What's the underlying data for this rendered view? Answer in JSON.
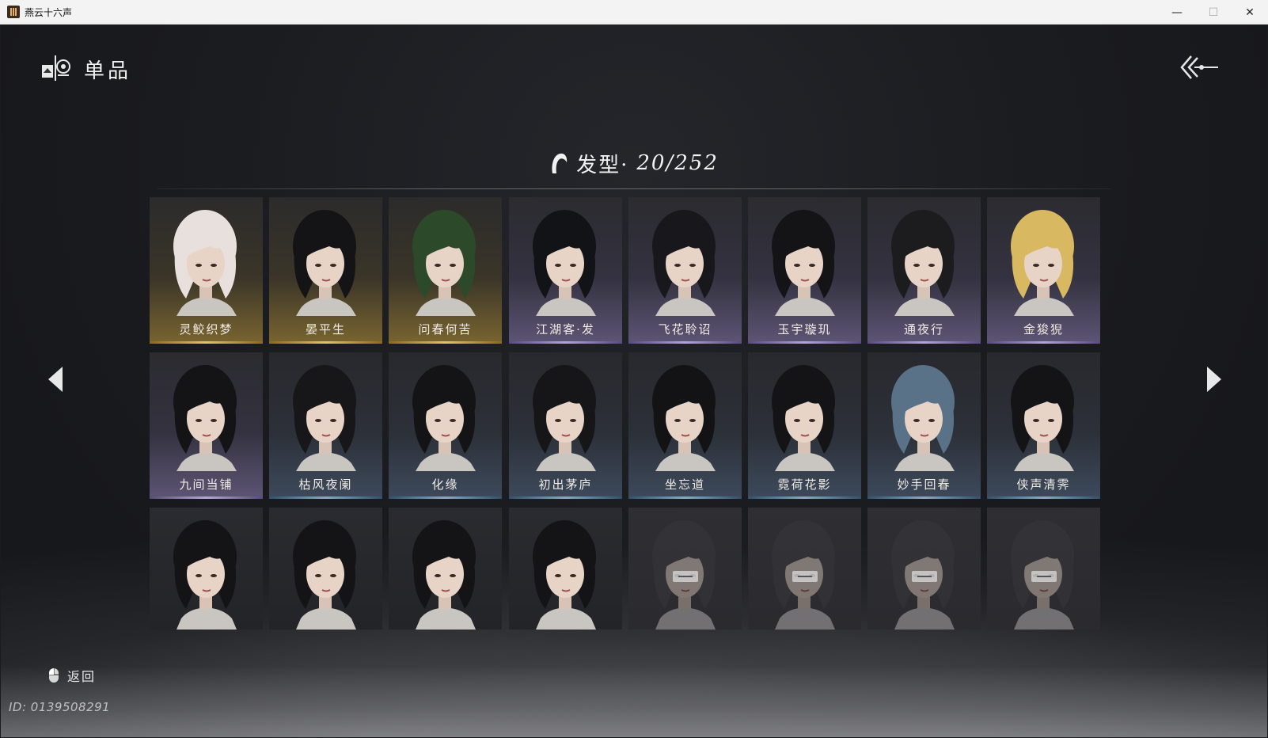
{
  "window": {
    "title": "燕云十六声",
    "minimize_glyph": "—",
    "maximize_glyph": "☐",
    "close_glyph": "✕"
  },
  "header": {
    "title": "单品",
    "icon": "item-icon",
    "back_icon": "double-chevron-left-icon"
  },
  "category": {
    "icon": "hair-icon",
    "label": "发型·",
    "count": "20/252"
  },
  "grid": {
    "cards": [
      {
        "name": "灵鲛织梦",
        "rarity": "gold",
        "hair": "#e8e0dc",
        "state": "owned"
      },
      {
        "name": "晏平生",
        "rarity": "gold",
        "hair": "#141416",
        "state": "owned"
      },
      {
        "name": "问春何苦",
        "rarity": "gold",
        "hair": "#2c4a2a",
        "state": "owned"
      },
      {
        "name": "江湖客·发",
        "rarity": "purple",
        "hair": "#121316",
        "state": "owned"
      },
      {
        "name": "飞花聆诏",
        "rarity": "purple",
        "hair": "#18181c",
        "state": "owned"
      },
      {
        "name": "玉宇璇玑",
        "rarity": "purple",
        "hair": "#141416",
        "state": "owned"
      },
      {
        "name": "通夜行",
        "rarity": "purple",
        "hair": "#1c1c1e",
        "state": "owned"
      },
      {
        "name": "金狻猊",
        "rarity": "purple",
        "hair": "#d8b860",
        "state": "owned"
      },
      {
        "name": "九间当铺",
        "rarity": "purple",
        "hair": "#141416",
        "state": "owned"
      },
      {
        "name": "枯风夜阑",
        "rarity": "blue",
        "hair": "#17171a",
        "state": "owned"
      },
      {
        "name": "化缘",
        "rarity": "blue",
        "hair": "#141416",
        "state": "owned"
      },
      {
        "name": "初出茅庐",
        "rarity": "blue",
        "hair": "#161618",
        "state": "owned"
      },
      {
        "name": "坐忘道",
        "rarity": "blue",
        "hair": "#131316",
        "state": "owned"
      },
      {
        "name": "霓荷花影",
        "rarity": "blue",
        "hair": "#141416",
        "state": "owned"
      },
      {
        "name": "妙手回春",
        "rarity": "blue",
        "hair": "#5a7288",
        "state": "owned"
      },
      {
        "name": "侠声清霁",
        "rarity": "blue",
        "hair": "#141416",
        "state": "owned"
      },
      {
        "name": "",
        "rarity": "plain",
        "hair": "#141416",
        "state": "owned"
      },
      {
        "name": "",
        "rarity": "plain",
        "hair": "#141416",
        "state": "owned"
      },
      {
        "name": "",
        "rarity": "plain",
        "hair": "#141416",
        "state": "owned"
      },
      {
        "name": "",
        "rarity": "plain",
        "hair": "#141416",
        "state": "owned"
      },
      {
        "name": "",
        "rarity": "locked",
        "hair": "#3a3a3e",
        "state": "locked"
      },
      {
        "name": "",
        "rarity": "locked",
        "hair": "#3a3a3e",
        "state": "locked"
      },
      {
        "name": "",
        "rarity": "locked",
        "hair": "#3a3a3e",
        "state": "locked"
      },
      {
        "name": "",
        "rarity": "locked",
        "hair": "#3a3a3e",
        "state": "locked"
      }
    ]
  },
  "nav": {
    "prev_icon": "triangle-left-icon",
    "next_icon": "triangle-right-icon"
  },
  "footer": {
    "back_label": "返回",
    "back_icon": "mouse-icon",
    "player_id": "ID: 0139508291"
  },
  "colors": {
    "gold": "#e2c36a",
    "purple": "#b7a2e0",
    "blue": "#84a8cc",
    "background": "#1b1c20"
  }
}
